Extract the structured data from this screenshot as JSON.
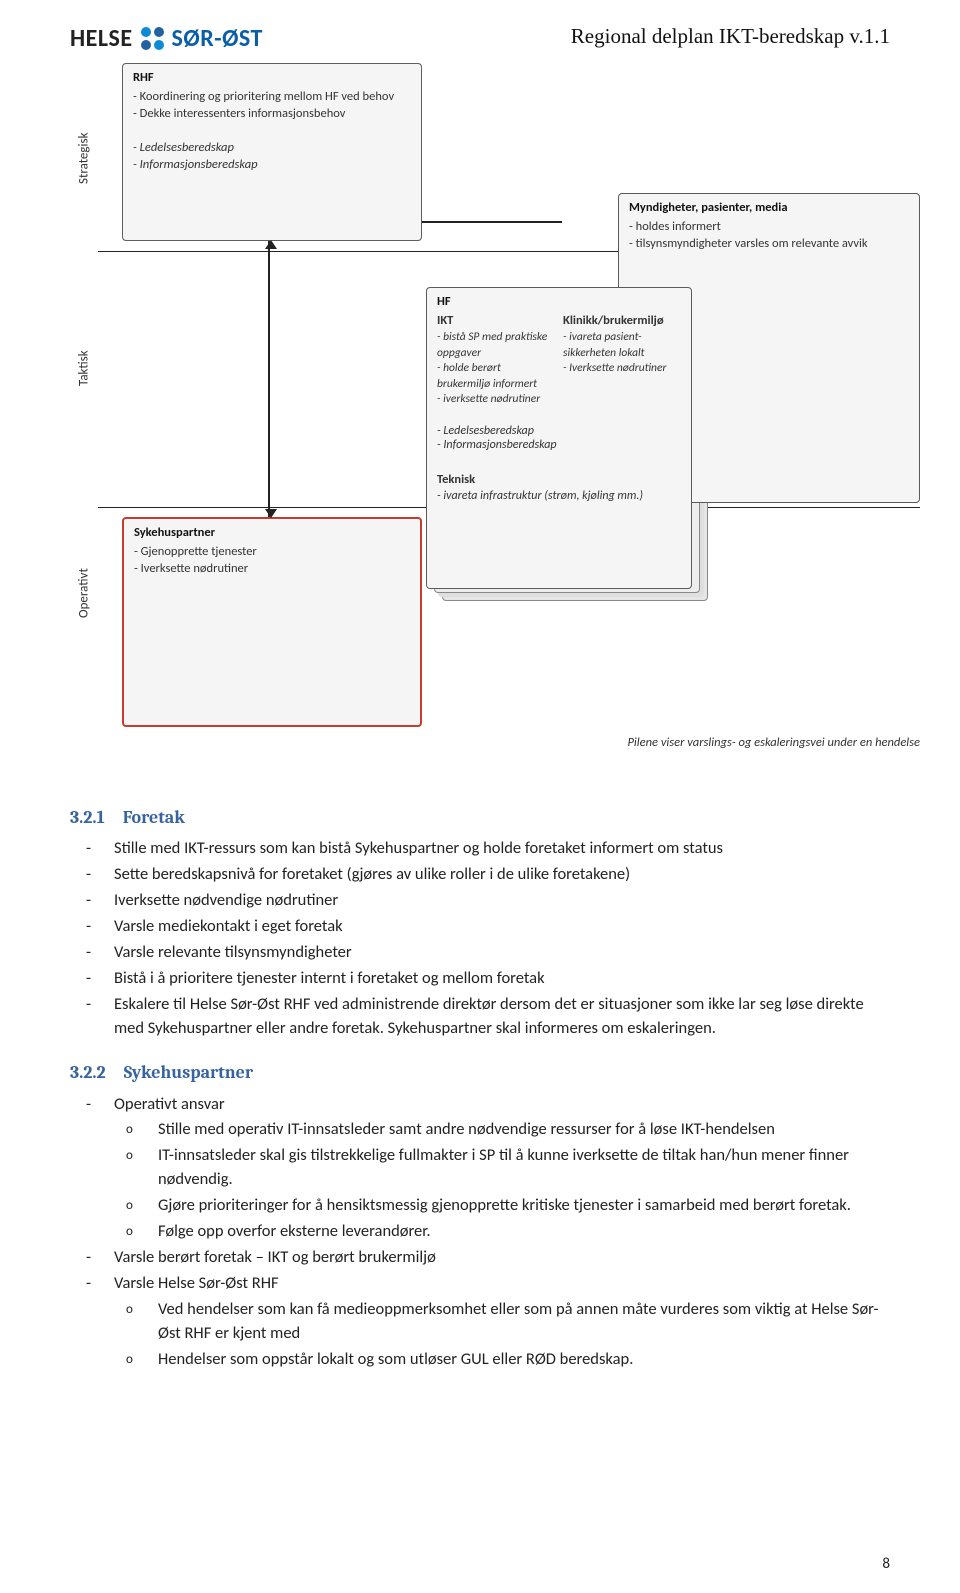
{
  "header": {
    "logo_left": "HELSE",
    "logo_right": "SØR-ØST",
    "title": "Regional delplan IKT-beredskap v.1.1"
  },
  "diagram": {
    "axis": {
      "strategisk": "Strategisk",
      "taktisk": "Taktisk",
      "operativt": "Operativt"
    },
    "rhf": {
      "title": "RHF",
      "l1": "- Koordinering og prioritering mellom HF ved behov",
      "l2": "- Dekke interessenters informasjonsbehov",
      "l3": "- Ledelsesberedskap",
      "l4": "- Informasjonsberedskap"
    },
    "mynd": {
      "title": "Myndigheter, pasienter, media",
      "l1": "- holdes informert",
      "l2": "- tilsynsmyndigheter varsles om relevante avvik"
    },
    "hf": {
      "title": "HF",
      "col1_title": "IKT",
      "col1_l1": "- bistå SP med praktiske oppgaver",
      "col1_l2": "- holde berørt brukermiljø informert",
      "col1_l3": "- iverksette nødrutiner",
      "col2_title": "Klinikk/brukermiljø",
      "col2_l1": "- ivareta pasient-sikkerheten lokalt",
      "col2_l2": "- Iverksette nødrutiner",
      "lower1": "- Ledelsesberedskap",
      "lower2": "- Informasjonsberedskap",
      "tech_title": "Teknisk",
      "tech_body": "- ivareta infrastruktur (strøm, kjøling mm.)"
    },
    "sp": {
      "title": "Sykehuspartner",
      "l1": "- Gjenopprette tjenester",
      "l2": "- Iverksette nødrutiner"
    },
    "footnote": "Pilene viser varslings- og eskaleringsvei under en hendelse"
  },
  "section321": {
    "num": "3.2.1",
    "title": "Foretak",
    "items": [
      "Stille med IKT-ressurs som kan bistå Sykehuspartner og holde foretaket informert om status",
      "Sette beredskapsnivå for foretaket (gjøres av ulike roller i de ulike foretakene)",
      "Iverksette nødvendige nødrutiner",
      "Varsle mediekontakt i eget foretak",
      "Varsle relevante tilsynsmyndigheter",
      "Bistå i å prioritere tjenester internt i foretaket og mellom foretak",
      "Eskalere til Helse Sør-Øst RHF ved administrende direktør dersom det er situasjoner som ikke lar seg løse direkte med Sykehuspartner eller andre foretak. Sykehuspartner skal informeres om eskaleringen."
    ]
  },
  "section322": {
    "num": "3.2.2",
    "title": "Sykehuspartner",
    "top_items": [
      "Operativt ansvar"
    ],
    "op_items": [
      "Stille med operativ IT-innsatsleder samt andre nødvendige ressurser for å løse IKT-hendelsen",
      "IT-innsatsleder skal gis tilstrekkelige fullmakter i SP til å kunne iverksette de tiltak han/hun mener finner nødvendig.",
      "Gjøre prioriteringer for å hensiktsmessig gjenopprette kritiske tjenester i samarbeid med berørt foretak.",
      "Følge opp overfor eksterne leverandører."
    ],
    "mid_items": [
      "Varsle berørt foretak – IKT og berørt brukermiljø",
      "Varsle Helse Sør-Øst RHF"
    ],
    "varsle_items": [
      "Ved hendelser som kan få medieoppmerksomhet eller som på annen måte vurderes som viktig at Helse Sør-Øst RHF er kjent med",
      "Hendelser som oppstår lokalt og som utløser GUL eller RØD beredskap."
    ]
  },
  "page_number": "8"
}
